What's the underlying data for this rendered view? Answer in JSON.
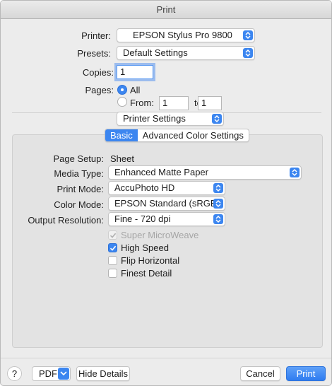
{
  "window": {
    "title": "Print"
  },
  "printer": {
    "label": "Printer:",
    "value": "EPSON Stylus Pro 9800"
  },
  "presets": {
    "label": "Presets:",
    "value": "Default Settings"
  },
  "copies": {
    "label": "Copies:",
    "value": "1"
  },
  "pages": {
    "label": "Pages:",
    "all_label": "All",
    "from_label": "From:",
    "from_value": "1",
    "to_label": "to:",
    "to_value": "1",
    "selected": "All"
  },
  "section_popup": {
    "value": "Printer Settings"
  },
  "tabs": [
    {
      "label": "Basic",
      "selected": true
    },
    {
      "label": "Advanced Color Settings",
      "selected": false
    }
  ],
  "settings": {
    "page_setup": {
      "label": "Page Setup:",
      "value": "Sheet"
    },
    "media_type": {
      "label": "Media Type:",
      "value": "Enhanced Matte Paper"
    },
    "print_mode": {
      "label": "Print Mode:",
      "value": "AccuPhoto HD"
    },
    "color_mode": {
      "label": "Color Mode:",
      "value": "EPSON Standard (sRGB)"
    },
    "output_resolution": {
      "label": "Output Resolution:",
      "value": "Fine - 720 dpi"
    }
  },
  "checkboxes": [
    {
      "label": "Super MicroWeave",
      "checked": true,
      "disabled": true
    },
    {
      "label": "High Speed",
      "checked": true,
      "disabled": false
    },
    {
      "label": "Flip Horizontal",
      "checked": false,
      "disabled": false
    },
    {
      "label": "Finest Detail",
      "checked": false,
      "disabled": false
    }
  ],
  "footer": {
    "help_label": "?",
    "pdf_label": "PDF",
    "hide_details_label": "Hide Details",
    "cancel_label": "Cancel",
    "print_label": "Print"
  },
  "colors": {
    "accent": "#3c86f0",
    "panel": "#e3e3e3",
    "window": "#ececec"
  },
  "icons": [
    "up-down-arrows-icon",
    "chevron-down-icon",
    "checkmark-icon"
  ]
}
